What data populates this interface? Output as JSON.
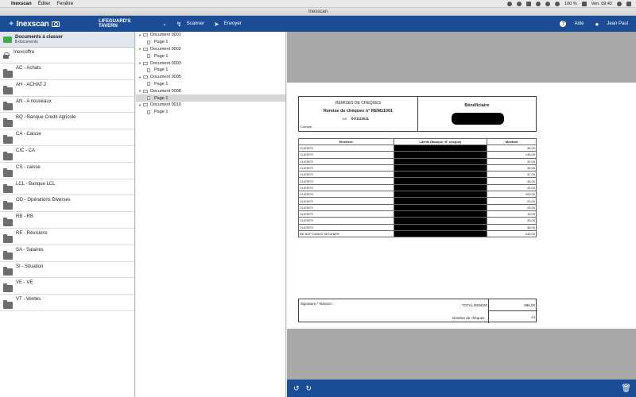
{
  "menubar": {
    "app": "Inexscan",
    "items": [
      "Éditer",
      "Fenêtre"
    ],
    "battery": "100 %",
    "clock": "Ven. 09:42"
  },
  "window": {
    "title": "Inexscan"
  },
  "toolbar": {
    "logo_text": "Inexscan",
    "company": "LIFEGUARD'S TAVERN",
    "scanner_label": "Scanner",
    "send_label": "Envoyer",
    "help_label": "Aide",
    "user_label": "Jean Paul"
  },
  "sidebar": {
    "inbox": {
      "title": "Documents à classer",
      "count": "5",
      "count_suffix": "documents"
    },
    "vault": "Inexcoffre",
    "folders": [
      "AC  -  Achats",
      "AH  -  ACHAT 2",
      "AN  -  A nouveaux",
      "BQ  -  Banque Credit Agricole",
      "CA  -  Caisse",
      "CIC  -  CA",
      "CS  -  caisse",
      "LCL  -  Banque LCL",
      "OD  -  Opérations Diverses",
      "RB  -  RB",
      "RE  -  Révisions",
      "SA  -  Salaires",
      "SI  -  Situation",
      "VE  -  VE",
      "VT  -  Ventes"
    ]
  },
  "tree": {
    "documents": [
      {
        "name": "Document 0001",
        "page": "Page 1"
      },
      {
        "name": "Document 0002",
        "page": "Page 1"
      },
      {
        "name": "Document 0003",
        "page": "Page 1"
      },
      {
        "name": "Document 0005",
        "page": "Page 1"
      },
      {
        "name": "Document 0008",
        "page": "Page 1"
      },
      {
        "name": "Document 0010",
        "page": "Page 1"
      }
    ],
    "selected_index": 4
  },
  "doc": {
    "header_title": "REMISES DE CHEQUES",
    "header_ref": "Remise de chèques n° REM11001",
    "date_label": "Le",
    "date_value": "07/11/2011",
    "compte_label": "Compte :",
    "beneficiary_label": "Bénéficiaire",
    "columns": [
      "Emetteur",
      "Libellé (Banque, N° chèque)",
      "Montant"
    ],
    "rows": [
      {
        "emetteur": "CLIENTS",
        "montant": "35,00"
      },
      {
        "emetteur": "CLIENTS",
        "montant": "135,00"
      },
      {
        "emetteur": "CLIENTS",
        "montant": "32,00"
      },
      {
        "emetteur": "CLIENTS",
        "montant": "30,00"
      },
      {
        "emetteur": "CLIENTS",
        "montant": "37,00"
      },
      {
        "emetteur": "CLIENTS",
        "montant": "35,00"
      },
      {
        "emetteur": "CLIENTS",
        "montant": "42,00"
      },
      {
        "emetteur": "CLIENTS",
        "montant": "200,00"
      },
      {
        "emetteur": "CLIENTS",
        "montant": "20,00"
      },
      {
        "emetteur": "CLIENTS",
        "montant": "29,00"
      },
      {
        "emetteur": "CLIENTS",
        "montant": "15,00"
      },
      {
        "emetteur": "CLIENTS",
        "montant": "30,00"
      },
      {
        "emetteur": "CLIENTS",
        "montant": "35,00"
      },
      {
        "emetteur": "BE BOP DANCE MOUNIER",
        "montant": "240,00"
      }
    ],
    "signature_label": "Signature / Tampon :",
    "total_label": "TOTAL REMISE",
    "total_value": "896,00",
    "count_label": "Nombre de chèques",
    "count_value": "14"
  }
}
